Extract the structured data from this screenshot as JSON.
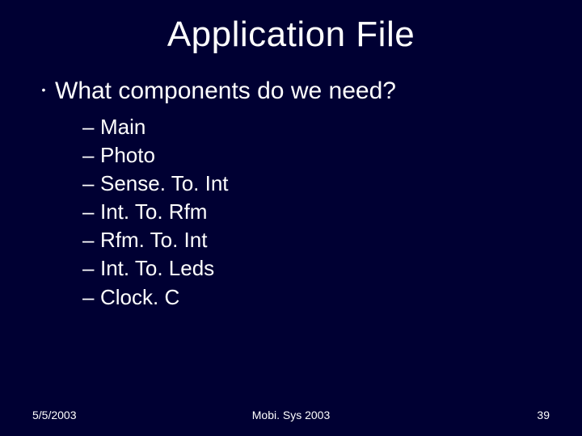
{
  "title": "Application File",
  "question": "What components do we need?",
  "items": [
    "Main",
    "Photo",
    "Sense. To. Int",
    "Int. To. Rfm",
    "Rfm. To. Int",
    "Int. To. Leds",
    "Clock. C"
  ],
  "footer": {
    "date": "5/5/2003",
    "venue": "Mobi. Sys 2003",
    "page": "39"
  }
}
